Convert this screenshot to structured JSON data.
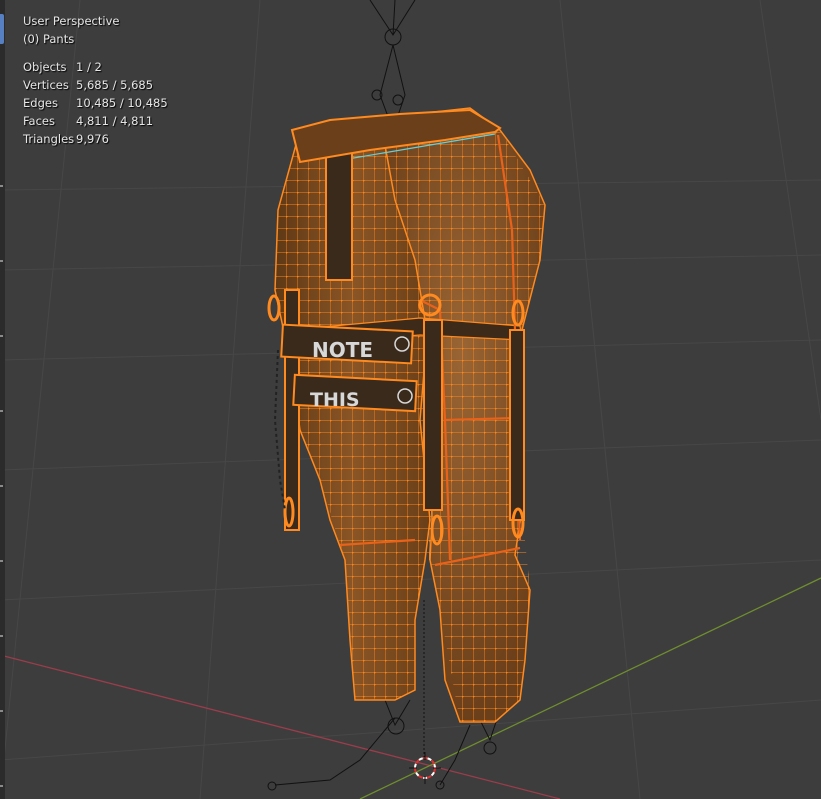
{
  "viewport": {
    "view_name": "User Perspective",
    "object_name": "(0) Pants"
  },
  "stats": [
    {
      "label": "Objects",
      "value": "1 / 2"
    },
    {
      "label": "Vertices",
      "value": "5,685 / 5,685"
    },
    {
      "label": "Edges",
      "value": "10,485 / 10,485"
    },
    {
      "label": "Faces",
      "value": "4,811 / 4,811"
    },
    {
      "label": "Triangles",
      "value": "9,976"
    }
  ],
  "mesh_labels": {
    "strap_upper": "NOTE",
    "strap_lower": "THIS"
  },
  "colors": {
    "background": "#3d3d3d",
    "grid": "#474747",
    "axis_x": "#9b3d4b",
    "axis_y": "#6f8f2e",
    "mesh_fill": "#7a4a22",
    "wire": "#ff8a1f",
    "selected_edge": "#e8621a"
  },
  "icons": [
    "3d-cursor-icon",
    "armature-bone-icon"
  ]
}
